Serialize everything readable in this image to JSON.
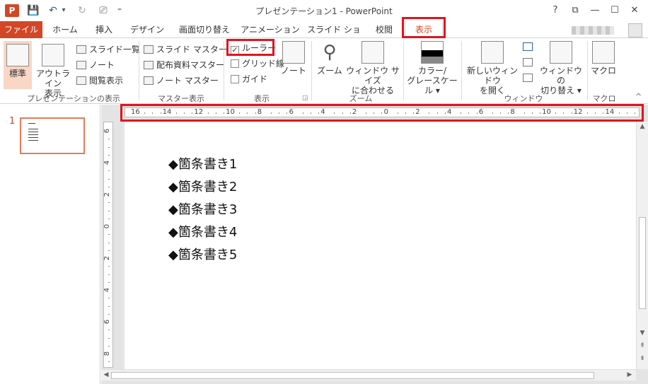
{
  "window": {
    "title": "プレゼンテーション1 - PowerPoint",
    "app_icon": "P",
    "help": "?",
    "ribbon_display": "⧉",
    "minimize": "—",
    "maximize": "☐",
    "close": "✕"
  },
  "qat": {
    "save": "💾",
    "undo": "↶",
    "undo_drop": "▾",
    "redo": "↻",
    "present": "⎚",
    "custom": "⁼"
  },
  "tabs": [
    "ファイル",
    "ホーム",
    "挿入",
    "デザイン",
    "画面切り替え",
    "アニメーション",
    "スライド ショー",
    "校閲",
    "表示"
  ],
  "ribbon": {
    "presentation_views": {
      "label": "プレゼンテーションの表示",
      "normal": "標準",
      "outline_line1": "アウトライン",
      "outline_line2": "表示",
      "slide_sorter": "スライド一覧",
      "notes_page": "ノート",
      "reading_view": "閲覧表示"
    },
    "master_views": {
      "label": "マスター表示",
      "slide_master": "スライド マスター",
      "handout_master": "配布資料マスター",
      "notes_master": "ノート マスター"
    },
    "show": {
      "label": "表示",
      "ruler": "ルーラー",
      "ruler_check": "✓",
      "gridlines": "グリッド線",
      "guides": "ガイド",
      "notes": "ノート",
      "launcher": "◲"
    },
    "zoom": {
      "label": "ズーム",
      "zoom": "ズーム",
      "fit_line1": "ウィンドウ サイズ",
      "fit_line2": "に合わせる"
    },
    "color": {
      "line1": "カラー/",
      "line2": "グレースケール ▾"
    },
    "window": {
      "label": "ウィンドウ",
      "new_line1": "新しいウィンドウ",
      "new_line2": "を開く",
      "switch_line1": "ウィンドウの",
      "switch_line2": "切り替え ▾"
    },
    "macros": {
      "label": "マクロ",
      "macro": "マクロ"
    },
    "collapse": "^"
  },
  "thumbnail": {
    "number": "1"
  },
  "hruler_labels": [
    "16",
    "14",
    "12",
    "10",
    "8",
    "6",
    "4",
    "2",
    "0",
    "2",
    "4",
    "6",
    "8",
    "10",
    "12",
    "14"
  ],
  "vruler_labels": [
    "6",
    "4",
    "2",
    "0",
    "2",
    "4",
    "6",
    "8"
  ],
  "slide": {
    "bullets": [
      "◆箇条書き1",
      "◆箇条書き2",
      "◆箇条書き3",
      "◆箇条書き4",
      "◆箇条書き5"
    ]
  },
  "scroll": {
    "up": "▲",
    "down": "▼",
    "prev": "⇞",
    "next": "⇟",
    "left": "◀",
    "right": "▶"
  },
  "colors": {
    "accent": "#d24726",
    "highlight": "#e0141e",
    "selected": "#f9d6c6"
  }
}
